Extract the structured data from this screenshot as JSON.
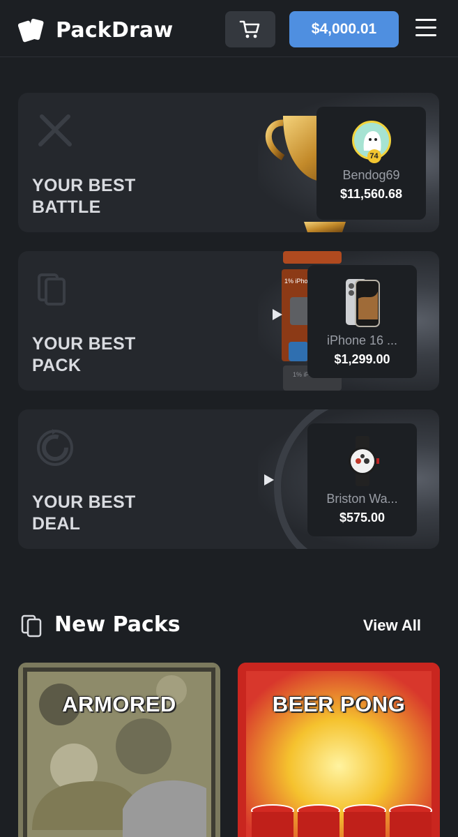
{
  "header": {
    "brand": "PackDraw",
    "balance": "$4,000.01"
  },
  "best_battle": {
    "title_line1": "YOUR BEST",
    "title_line2": "BATTLE",
    "user_name": "Bendog69",
    "user_level": "74",
    "value": "$11,560.68"
  },
  "best_pack": {
    "title_line1": "YOUR BEST",
    "title_line2": "PACK",
    "item_name": "iPhone 16 ...",
    "value": "$1,299.00",
    "stack_label": "1% iPhone"
  },
  "best_deal": {
    "title_line1": "YOUR BEST",
    "title_line2": "DEAL",
    "item_name": "Briston Wa...",
    "value": "$575.00"
  },
  "new_packs": {
    "title": "New Packs",
    "view_all": "View All",
    "packs": [
      {
        "name": "ARMORED"
      },
      {
        "name": "BEER PONG"
      }
    ]
  },
  "colors": {
    "background": "#1c1f23",
    "card": "#25282d",
    "accent": "#4f8fe0"
  }
}
